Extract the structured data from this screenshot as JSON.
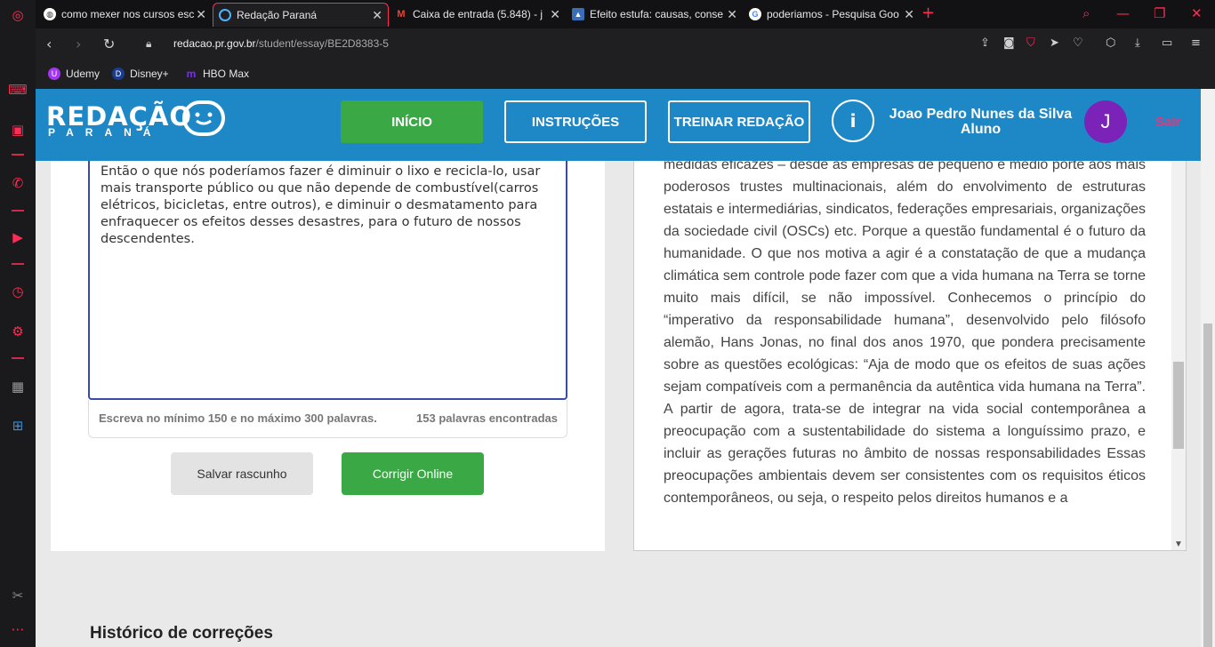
{
  "browser": {
    "tabs": [
      {
        "label": "como mexer nos cursos esc",
        "favicon": "globe-icon"
      },
      {
        "label": "Redação Paraná",
        "favicon": "chat-icon",
        "active": true
      },
      {
        "label": "Caixa de entrada (5.848) - j",
        "favicon": "gmail-icon"
      },
      {
        "label": "Efeito estufa: causas, conse",
        "favicon": "site-icon"
      },
      {
        "label": "poderiamos - Pesquisa Goo",
        "favicon": "google-icon"
      }
    ],
    "url_host": "redacao.pr.gov.br",
    "url_path": "/student/essay/BE2D8383-5",
    "bookmarks": [
      {
        "label": "Udemy",
        "color": "#a435f0"
      },
      {
        "label": "Disney+",
        "color": "#1a3d8f"
      },
      {
        "label": "HBO Max",
        "color": "#7a2bf5"
      }
    ]
  },
  "header": {
    "logo_main": "REDAÇÃO",
    "logo_sub": "PARANÁ",
    "nav": {
      "inicio": "INÍCIO",
      "instrucoes": "INSTRUÇÕES",
      "treinar": "TREINAR REDAÇÃO"
    },
    "user_name": "Joao Pedro Nunes da Silva",
    "user_role": "Aluno",
    "avatar_letter": "J",
    "logout": "Sair",
    "info_symbol": "i"
  },
  "editor": {
    "text": " Então o que nós poderíamos fazer é diminuir o lixo e recicla-lo, usar mais transporte público ou que não depende de combustível(carros elétricos, bicicletas, entre outros), e diminuir o desmatamento para enfraquecer os efeitos desses desastres, para o futuro de nossos descendentes.",
    "limit_hint": "Escreva no mínimo 150 e no máximo 300 palavras.",
    "word_count": "153 palavras encontradas",
    "save_draft": "Salvar rascunho",
    "correct_online": "Corrigir Online"
  },
  "reference_text": "medidas eficazes – desde as empresas de pequeno e médio porte aos mais poderosos trustes multinacionais, além do envolvimento de estruturas estatais e intermediárias, sindicatos, federações empresariais, organizações da sociedade civil (OSCs) etc. Porque a questão fundamental é o futuro da humanidade. O que nos motiva a agir é a constatação de que a mudança climática sem controle pode fazer com que a vida humana na Terra se torne muito mais difícil, se não impossível. Conhecemos o princípio do “imperativo da responsabilidade humana”, desenvolvido pelo filósofo alemão, Hans Jonas, no final dos anos 1970, que pondera precisamente sobre as questões ecológicas: “Aja de modo que os efeitos de suas ações sejam compatíveis com a permanência da autêntica vida humana na Terra”. A partir de agora, trata-se de integrar na vida social contemporânea a preocupação com a sustentabilidade do sistema a longuíssimo prazo, e incluir as gerações futuras no âmbito de nossas responsabilidades Essas preocupações ambientais devem ser consistentes com os requisitos éticos contemporâneos, ou seja, o respeito pelos direitos humanos e a",
  "history_title": "Histórico de correções"
}
